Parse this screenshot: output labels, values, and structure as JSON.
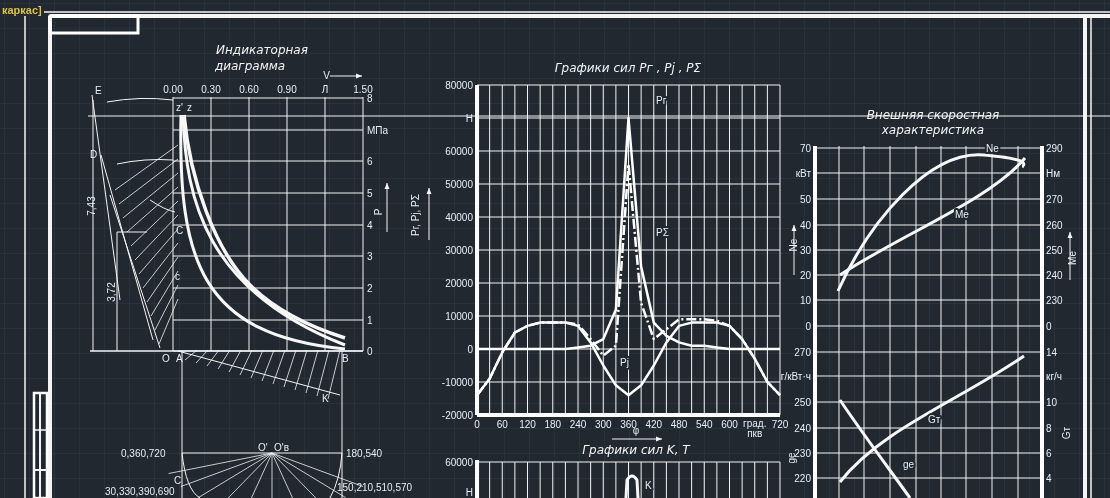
{
  "viewport_label": "каркас]",
  "indicator_diagram": {
    "title_lines": [
      "Индикаторная",
      "диаграмма"
    ],
    "x_ticks": [
      "0.00",
      "0.30",
      "0.60",
      "0.90",
      "Л",
      "1.50"
    ],
    "x_axis_label": "V",
    "y_ticks": [
      "8",
      "МПа",
      "6",
      "5",
      "4",
      "3",
      "2",
      "1",
      "0"
    ],
    "y_axis_label": "P",
    "point_labels": [
      "E",
      "D",
      "z'",
      "z",
      "C",
      "c",
      "O",
      "A",
      "B",
      "K"
    ],
    "dimension_labels": [
      "7,43",
      "3,72"
    ]
  },
  "brix_diagram": {
    "labels": [
      "0,360,720",
      "O'",
      "O'в",
      "180,540",
      "C",
      "150,210,510,570",
      "30,330,390,690"
    ]
  },
  "force_chart": {
    "chart_data": {
      "type": "line",
      "title": "Графики сил  Pг ,  Pj ,  PΣ",
      "xlabel": "φ",
      "ylabel": "Pг, Pj, PΣ",
      "x": [
        0,
        30,
        60,
        90,
        120,
        150,
        180,
        210,
        240,
        270,
        300,
        330,
        360,
        390,
        420,
        450,
        480,
        510,
        540,
        570,
        600,
        630,
        660,
        690,
        720
      ],
      "series": [
        {
          "name": "Pг",
          "color": "#ffffff",
          "line_style": "solid",
          "values": [
            0,
            0,
            0,
            0,
            0,
            0,
            0,
            0,
            500,
            1000,
            3000,
            12000,
            70000,
            25000,
            8000,
            4000,
            2000,
            1000,
            1000,
            500,
            0,
            0,
            0,
            0,
            0
          ]
        },
        {
          "name": "Pj",
          "color": "#ffffff",
          "line_style": "solid",
          "values": [
            -14000,
            -9000,
            -1000,
            5000,
            7000,
            8000,
            8000,
            8000,
            7000,
            2000,
            -5000,
            -11000,
            -14000,
            -11000,
            -5000,
            2000,
            7000,
            8000,
            8000,
            8000,
            7000,
            3000,
            -3000,
            -10000,
            -14000
          ]
        },
        {
          "name": "PΣ",
          "color": "#ffffff",
          "line_style": "dash-dot",
          "values": [
            -14000,
            -9000,
            -1000,
            5000,
            7000,
            8000,
            8000,
            8000,
            7500,
            3000,
            -2000,
            1000,
            56000,
            14000,
            3000,
            6000,
            9000,
            9000,
            9000,
            8500,
            7000,
            3000,
            -3000,
            -10000,
            -14000
          ]
        }
      ],
      "grid": true,
      "xlim": [
        0,
        720
      ],
      "ylim": [
        -20000,
        80000
      ],
      "xticks": [
        0,
        60,
        120,
        180,
        240,
        300,
        360,
        420,
        480,
        540,
        600,
        {
          "value": 660,
          "label": "град. пкв"
        },
        720
      ],
      "yticks": [
        80000,
        {
          "value": 70000,
          "label": "Н"
        },
        60000,
        50000,
        40000,
        30000,
        20000,
        10000,
        0,
        -10000,
        -20000
      ]
    }
  },
  "force_chart_kt": {
    "title": "Графики сил  K,  T",
    "y_ticks": [
      "60000",
      "Н"
    ],
    "curve_labels": [
      "K"
    ]
  },
  "speed_characteristic": {
    "title_lines": [
      "Внешняя скоростная",
      "характеристика"
    ],
    "upper": {
      "left_ticks": [
        "70",
        "кВт",
        "50",
        "40",
        "30",
        "20",
        "10",
        "0"
      ],
      "right_ticks": [
        "290",
        "Нм",
        "270",
        "260",
        "250",
        "240",
        "230",
        "0"
      ],
      "left_label": "Ne",
      "right_label": "Me",
      "curve_labels": [
        "Ne",
        "Me"
      ]
    },
    "lower": {
      "left_ticks": [
        "270",
        "г/кВт·ч",
        "250",
        "240",
        "230",
        "220"
      ],
      "right_ticks": [
        "14",
        "кг/ч",
        "10",
        "8",
        "6",
        "4"
      ],
      "left_label": "ge",
      "right_label": "Gт",
      "curve_labels": [
        "Gт",
        "ge"
      ]
    }
  }
}
